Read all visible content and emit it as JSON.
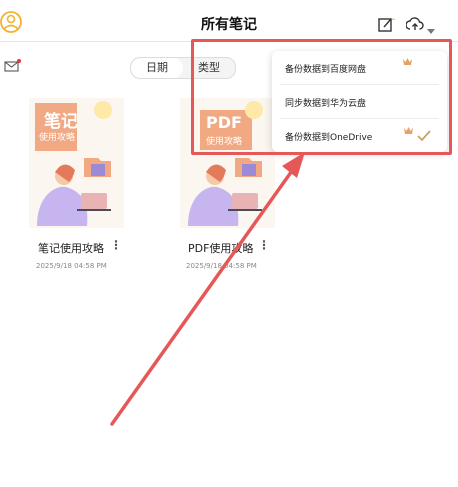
{
  "header": {
    "title": "所有笔记",
    "icons": [
      "avatar-icon",
      "mail-icon",
      "edit-icon",
      "cloud-upload-icon",
      "dropdown-arrow-icon"
    ]
  },
  "sort_tabs": [
    {
      "label": "日期",
      "active": true
    },
    {
      "label": "类型",
      "active": false
    }
  ],
  "notes": [
    {
      "title": "笔记使用攻略",
      "date": "2025/9/18 04:58 PM",
      "cover_text": [
        "笔记",
        "使用攻略"
      ]
    },
    {
      "title": "PDF使用攻略",
      "date": "2025/9/18 04:58 PM",
      "cover_text": [
        "PDF",
        "使用攻略"
      ]
    }
  ],
  "backup_menu": {
    "items": [
      {
        "label": "备份数据到百度网盘",
        "crown": true,
        "checked": false
      },
      {
        "label": "同步数据到华为云盘",
        "crown": false,
        "checked": false
      },
      {
        "label": "备份数据到OneDrive",
        "crown": true,
        "checked": true
      }
    ]
  },
  "colors": {
    "highlight": "#e65858",
    "crown": "#e7a261",
    "check": "#c9a45c",
    "cover_orange": "#f0a982",
    "cover_yellow": "#ffe9a8"
  }
}
